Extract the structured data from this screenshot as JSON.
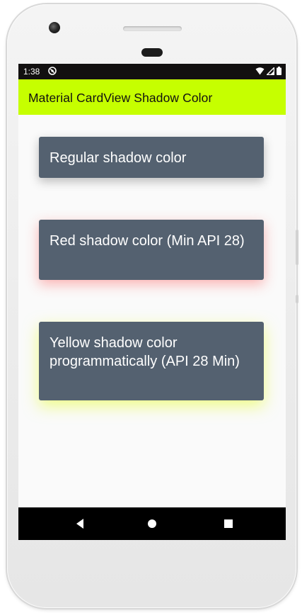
{
  "status_bar": {
    "time": "1:38",
    "icons": [
      "dnd-icon",
      "wifi-icon",
      "signal-icon",
      "battery-icon"
    ]
  },
  "app_bar": {
    "title": "Material CardView Shadow Color",
    "color": "#c6ff00"
  },
  "cards": [
    {
      "text": "Regular shadow color",
      "shadow_color": "#000000"
    },
    {
      "text": "Red shadow color (Min API 28)",
      "shadow_color": "#ff3c3c"
    },
    {
      "text": "Yellow shadow color programmatically (API 28 Min)",
      "shadow_color": "#e6ff28"
    }
  ],
  "card_background": "#546170",
  "navigation": {
    "buttons": [
      "back-icon",
      "home-icon",
      "recents-icon"
    ]
  }
}
